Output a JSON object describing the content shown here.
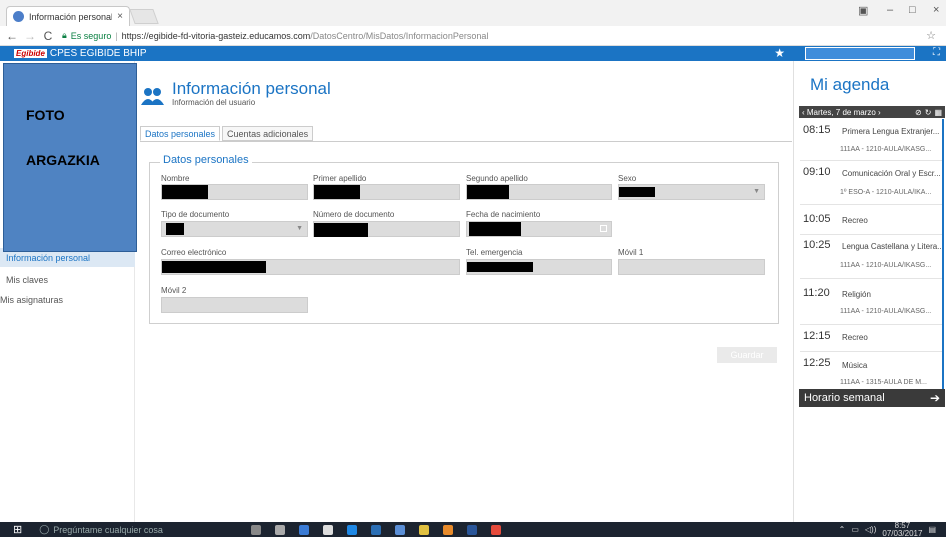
{
  "browser": {
    "tab_title": "Información personal",
    "tab_close": "×",
    "secure_label": "Es seguro",
    "url_host": "https://egibide-fd-vitoria-gasteiz.educamos.com",
    "url_path": "/DatosCentro/MisDatos/InformacionPersonal",
    "back": "←",
    "forward": "→",
    "reload": "C",
    "minimize": "–",
    "maximize": "□",
    "close": "×"
  },
  "appbar": {
    "logo": "Egibide",
    "name": "CPES EGIBIDE BHIP",
    "star": "★",
    "expand": "⛶"
  },
  "photo": {
    "line1": "FOTO",
    "line2": "ARGAZKIA"
  },
  "sidebar": {
    "items": [
      {
        "label": "Información personal"
      },
      {
        "label": "Mis claves"
      },
      {
        "label": "Mis asignaturas"
      }
    ]
  },
  "main": {
    "title": "Información personal",
    "subtitle": "Información del usuario",
    "tabs": [
      {
        "label": "Datos personales"
      },
      {
        "label": "Cuentas adicionales"
      }
    ],
    "section_title": "Datos personales",
    "fields": {
      "nombre": "Nombre",
      "primer_apellido": "Primer apellido",
      "segundo_apellido": "Segundo apellido",
      "sexo": "Sexo",
      "tipo_documento": "Tipo de documento",
      "numero_documento": "Número de documento",
      "fecha_nacimiento": "Fecha de nacimiento",
      "correo": "Correo electrónico",
      "tel_emergencia": "Tel. emergencia",
      "movil1": "Móvil 1",
      "movil2": "Móvil 2"
    },
    "save_label": "Guardar"
  },
  "agenda": {
    "title": "Mi agenda",
    "date": "‹ Martes, 7 de marzo ›",
    "items": [
      {
        "time": "08:15",
        "subject": "Primera Lengua Extranjer...",
        "room": "111AA - 1210-AULA/IKASG..."
      },
      {
        "time": "09:10",
        "subject": "Comunicación Oral y Escr...",
        "room": "1º ESO-A - 1210-AULA/IKA..."
      },
      {
        "time": "10:05",
        "subject": "Recreo",
        "room": ""
      },
      {
        "time": "10:25",
        "subject": "Lengua Castellana y Litera...",
        "room": "111AA - 1210-AULA/IKASG..."
      },
      {
        "time": "11:20",
        "subject": "Religión",
        "room": "111AA - 1210-AULA/IKASG..."
      },
      {
        "time": "12:15",
        "subject": "Recreo",
        "room": ""
      },
      {
        "time": "12:25",
        "subject": "Música",
        "room": "111AA - 1315-AULA DE M..."
      }
    ],
    "weekly_label": "Horario semanal"
  },
  "taskbar": {
    "search_placeholder": "Pregúntame cualquier cosa",
    "time": "8:57",
    "date": "07/03/2017"
  },
  "colors": {
    "brand": "#1b74c4",
    "photo": "#4f83c2",
    "taskbar": "#1c2430"
  }
}
